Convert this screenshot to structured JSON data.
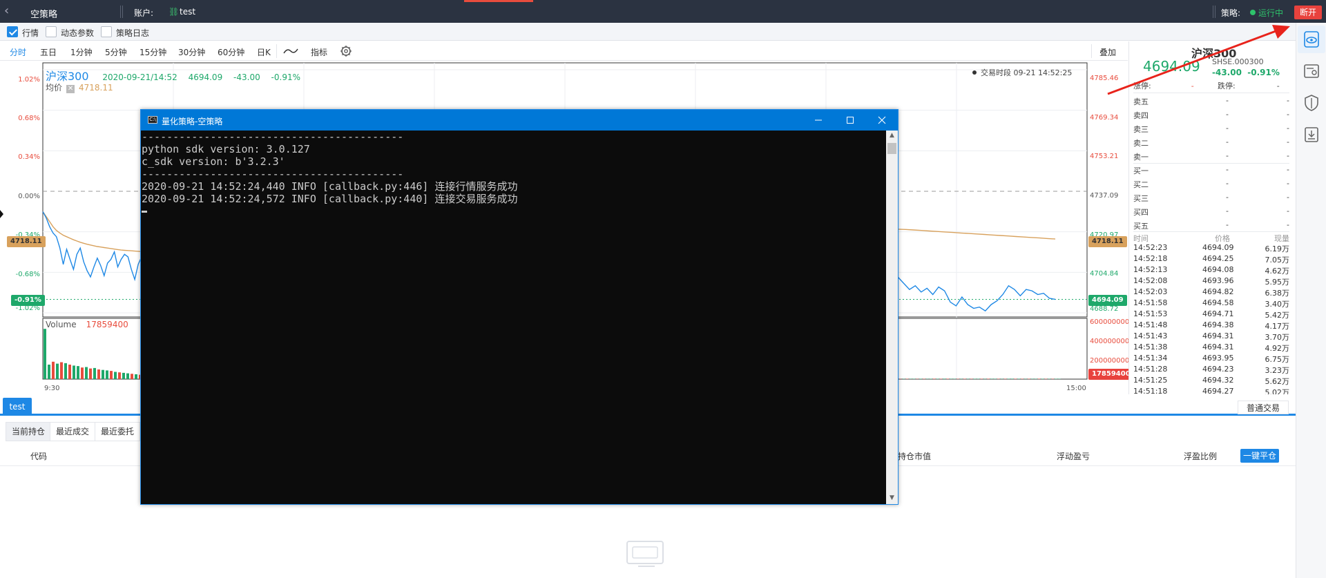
{
  "topbar": {
    "title": "空策略",
    "account_label": "账户:",
    "account_value": "test",
    "strategy_label": "策略:",
    "status": "运行中",
    "disconnect": "断开"
  },
  "checks": [
    {
      "label": "行情",
      "checked": true
    },
    {
      "label": "动态参数",
      "checked": false
    },
    {
      "label": "策略日志",
      "checked": false
    }
  ],
  "timeframes": {
    "items": [
      "分时",
      "五日",
      "1分钟",
      "5分钟",
      "15分钟",
      "30分钟",
      "60分钟",
      "日K"
    ],
    "indicator": "指标",
    "overlay": "叠加"
  },
  "chart": {
    "name": "沪深300",
    "time": "2020-09-21/14:52",
    "price": "4694.09",
    "change": "-43.00",
    "pct": "-0.91%",
    "avg_label": "均价",
    "avg_value": "4718.11",
    "session": "交易时段 09-21 14:52:25",
    "left_axis": [
      "1.02%",
      "0.68%",
      "0.34%",
      "0.00%",
      "-0.34%",
      "-0.68%",
      "-1.02%"
    ],
    "right_axis": [
      "4785.46",
      "4769.34",
      "4753.21",
      "4737.09",
      "4720.97",
      "4704.84",
      "4688.72"
    ],
    "avg_tag": "4718.11",
    "price_tag_left": "-0.91%",
    "price_tag_right": "4694.09",
    "volume_label": "Volume",
    "volume_value": "17859400",
    "volume_axis": [
      "600000000",
      "400000000",
      "200000000"
    ],
    "volume_tag": "17859400",
    "time_start": "9:30",
    "time_end": "15:00",
    "price_series_left": [
      4729.0,
      4726.5,
      4723.0,
      4720.5,
      4719.0,
      4714.5,
      4708.0,
      4714.0,
      4710.0,
      4706.0,
      4712.0,
      4714.5,
      4709.0,
      4705.5,
      4703.0,
      4707.0,
      4710.5,
      4707.5,
      4703.5,
      4708.5,
      4710.0,
      4713.0,
      4707.0,
      4710.0,
      4712.0,
      4711.0,
      4706.0,
      4702.0,
      4708.0,
      4711.0
    ],
    "avg_series_left": [
      4729.0,
      4727.0,
      4725.0,
      4723.0,
      4721.5,
      4720.5,
      4719.6,
      4719.0,
      4718.4,
      4717.8,
      4717.3,
      4716.8,
      4716.4,
      4716.0,
      4715.7,
      4715.4,
      4715.1,
      4714.9,
      4714.7,
      4714.5,
      4714.3,
      4714.1,
      4713.9,
      4713.7,
      4713.6,
      4713.5,
      4713.4,
      4713.3,
      4713.2,
      4713.1
    ],
    "price_series_right": [
      4703.0,
      4700.5,
      4698.0,
      4699.5,
      4697.0,
      4698.5,
      4696.0,
      4699.0,
      4697.5,
      4693.0,
      4691.5,
      4695.0,
      4692.0,
      4690.5,
      4691.0,
      4689.5,
      4692.0,
      4693.5,
      4696.0,
      4699.5,
      4698.0,
      4695.5,
      4698.0,
      4697.5,
      4696.0,
      4696.5,
      4694.5,
      4694.09
    ],
    "avg_series_right": [
      4722.0,
      4721.9,
      4721.7,
      4721.5,
      4721.3,
      4721.1,
      4720.9,
      4720.7,
      4720.5,
      4720.3,
      4720.1,
      4719.9,
      4719.7,
      4719.5,
      4719.3,
      4719.1,
      4718.9,
      4718.7,
      4718.5,
      4718.3,
      4718.11
    ],
    "volume_left": [
      520,
      150,
      180,
      160,
      175,
      165,
      150,
      140,
      135,
      120,
      125,
      110,
      115,
      100,
      95,
      90,
      85,
      75,
      70,
      65,
      60,
      55,
      50,
      45
    ],
    "volume_left_up": [
      false,
      false,
      true,
      false,
      true,
      false,
      true,
      false,
      false,
      true,
      false,
      true,
      false,
      true,
      false,
      false,
      true,
      false,
      true,
      false,
      false,
      true,
      false,
      true
    ],
    "volume_right": [
      22,
      28,
      30,
      26,
      32,
      24,
      35,
      30,
      28,
      36,
      40,
      34,
      30,
      42,
      38,
      28,
      32,
      30,
      26,
      34,
      30,
      28,
      36,
      32,
      30,
      28,
      38,
      30,
      34,
      32,
      26,
      30,
      35,
      40,
      36,
      34,
      30,
      28,
      32,
      30,
      34,
      38,
      36,
      30,
      32,
      28,
      34,
      30
    ],
    "volume_right_up": [
      true,
      false,
      true,
      false,
      false,
      true,
      false,
      true,
      false,
      false,
      true,
      false,
      true,
      false,
      true,
      false,
      false,
      true,
      false,
      true,
      false,
      true,
      false,
      false,
      true,
      false,
      true,
      false,
      false,
      true,
      false,
      true,
      false,
      false,
      true,
      false,
      true,
      false,
      true,
      false,
      false,
      true,
      false,
      true,
      false,
      true,
      false,
      false
    ]
  },
  "quote": {
    "name": "沪深300",
    "price": "4694.09",
    "code": "SHSE.000300",
    "change": "-43.00",
    "pct": "-0.91%",
    "limit_up_label": "涨停:",
    "limit_up_value": "-",
    "limit_down_label": "跌停:",
    "limit_down_value": "-",
    "asks": [
      {
        "label": "卖五",
        "price": "-",
        "vol": "-"
      },
      {
        "label": "卖四",
        "price": "-",
        "vol": "-"
      },
      {
        "label": "卖三",
        "price": "-",
        "vol": "-"
      },
      {
        "label": "卖二",
        "price": "-",
        "vol": "-"
      },
      {
        "label": "卖一",
        "price": "-",
        "vol": "-"
      }
    ],
    "bids": [
      {
        "label": "买一",
        "price": "-",
        "vol": "-"
      },
      {
        "label": "买二",
        "price": "-",
        "vol": "-"
      },
      {
        "label": "买三",
        "price": "-",
        "vol": "-"
      },
      {
        "label": "买四",
        "price": "-",
        "vol": "-"
      },
      {
        "label": "买五",
        "price": "-",
        "vol": "-"
      }
    ],
    "ticks_header": {
      "time": "时间",
      "price": "价格",
      "vol": "现量"
    },
    "ticks": [
      {
        "time": "14:52:23",
        "price": "4694.09",
        "vol": "6.19万"
      },
      {
        "time": "14:52:18",
        "price": "4694.25",
        "vol": "7.05万"
      },
      {
        "time": "14:52:13",
        "price": "4694.08",
        "vol": "4.62万"
      },
      {
        "time": "14:52:08",
        "price": "4693.96",
        "vol": "5.95万"
      },
      {
        "time": "14:52:03",
        "price": "4694.82",
        "vol": "6.38万"
      },
      {
        "time": "14:51:58",
        "price": "4694.58",
        "vol": "3.40万"
      },
      {
        "time": "14:51:53",
        "price": "4694.71",
        "vol": "5.42万"
      },
      {
        "time": "14:51:48",
        "price": "4694.38",
        "vol": "4.17万"
      },
      {
        "time": "14:51:43",
        "price": "4694.31",
        "vol": "3.70万"
      },
      {
        "time": "14:51:38",
        "price": "4694.31",
        "vol": "4.92万"
      },
      {
        "time": "14:51:34",
        "price": "4693.95",
        "vol": "6.75万"
      },
      {
        "time": "14:51:28",
        "price": "4694.23",
        "vol": "3.23万"
      },
      {
        "time": "14:51:25",
        "price": "4694.32",
        "vol": "5.62万"
      },
      {
        "time": "14:51:18",
        "price": "4694.27",
        "vol": "5.02万"
      }
    ]
  },
  "bottom": {
    "account_tab": "test",
    "normal_trade": "普通交易",
    "subtabs": [
      "当前持仓",
      "最近成交",
      "最近委托"
    ],
    "col_code": "代码",
    "col_market_value": "持仓市值",
    "col_float_pnl": "浮动盈亏",
    "col_float_ratio": "浮盈比例",
    "close_all": "一键平仓"
  },
  "console": {
    "title": "量化策略-空策略",
    "icon_text": "C:\\",
    "lines": [
      "------------------------------------------",
      "python sdk version: 3.0.127",
      "c_sdk version: b'3.2.3'",
      "------------------------------------------",
      "2020-09-21 14:52:24,440 INFO [callback.py:446] 连接行情服务成功",
      "2020-09-21 14:52:24,572 INFO [callback.py:440] 连接交易服务成功"
    ]
  },
  "colors": {
    "accent": "#1e88e5",
    "up": "#e84c3d",
    "down": "#1ea86a",
    "avg": "#d8a15c",
    "topbar": "#2b3341"
  }
}
